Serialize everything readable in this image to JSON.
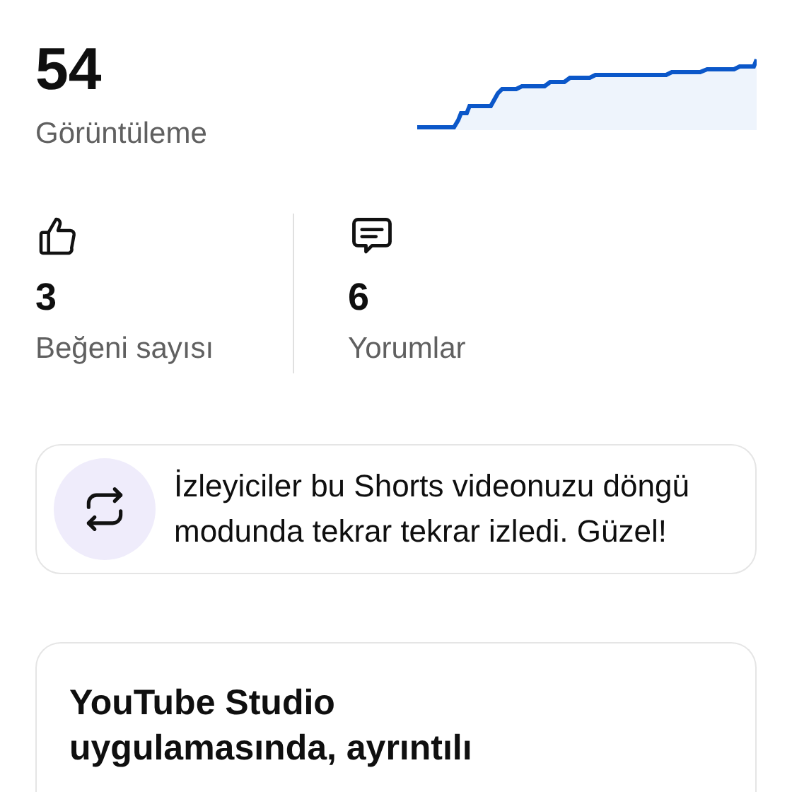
{
  "views": {
    "value": "54",
    "label": "Görüntüleme"
  },
  "stats": [
    {
      "kind": "likes",
      "value": "3",
      "label": "Beğeni sayısı"
    },
    {
      "kind": "comments",
      "value": "6",
      "label": "Yorumlar"
    }
  ],
  "insight": {
    "text": "İzleyiciler bu Shorts videonuzu döngü modunda tekrar tekrar izledi. Güzel!"
  },
  "promo": {
    "title": "YouTube Studio uygulamasında, ayrıntılı"
  }
}
